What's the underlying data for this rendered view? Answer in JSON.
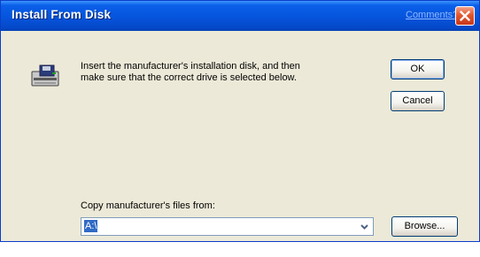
{
  "window": {
    "title": "Install From Disk",
    "comments_link": "Comments?",
    "close_icon": "close-icon"
  },
  "message": {
    "line1": "Insert the manufacturer's installation disk, and then",
    "line2": "make sure that the correct drive is selected below.",
    "icon": "floppy-disk-drive-icon"
  },
  "buttons": {
    "ok": "OK",
    "cancel": "Cancel",
    "browse": "Browse..."
  },
  "copy_from": {
    "label": "Copy manufacturer's files from:",
    "value": "A:\\"
  },
  "colors": {
    "titlebar": "#0654dc",
    "dialog_bg": "#ece9d8",
    "selection": "#316ac5",
    "close_button": "#e1572f"
  }
}
